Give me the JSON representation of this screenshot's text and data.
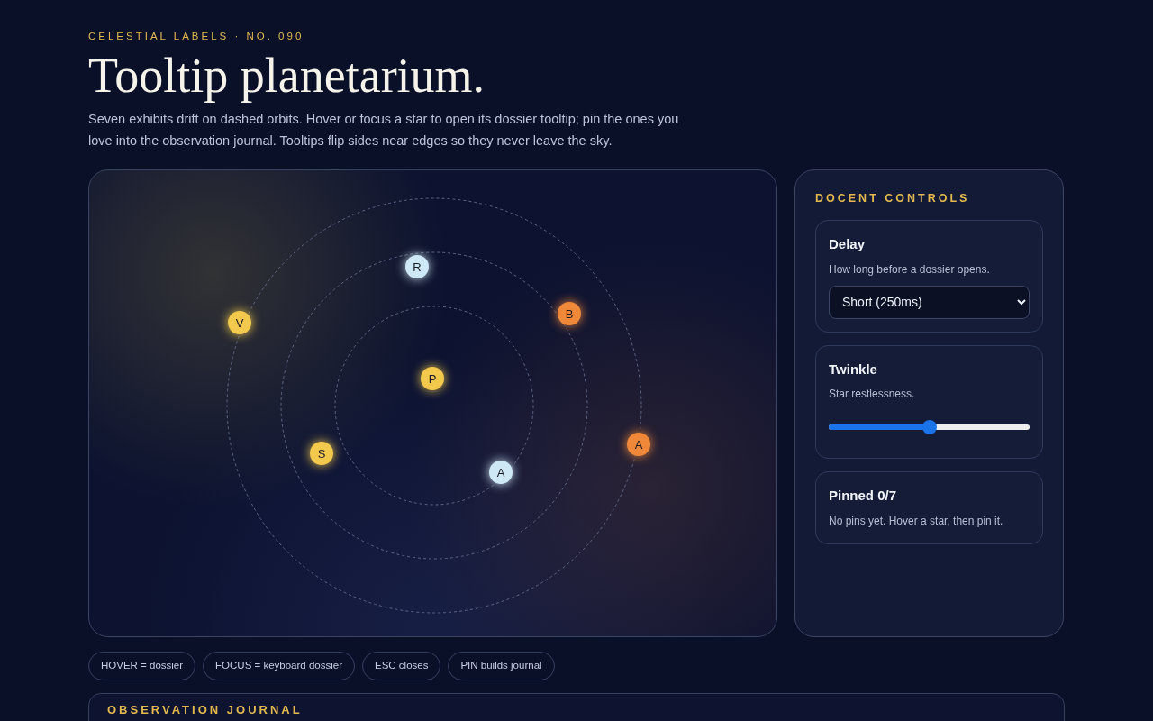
{
  "eyebrow": "CELESTIAL LABELS · NO. 090",
  "title": "Tooltip planetarium.",
  "intro": "Seven exhibits drift on dashed orbits. Hover or focus a star to open its dossier tooltip; pin the ones you love into the observation journal. Tooltips flip sides near edges so they never leave the sky.",
  "stars": [
    {
      "label": "R",
      "color": "#cfe8f5"
    },
    {
      "label": "B",
      "color": "#f0883a"
    },
    {
      "label": "V",
      "color": "#f2c94c"
    },
    {
      "label": "P",
      "color": "#f2c94c"
    },
    {
      "label": "S",
      "color": "#f2c94c"
    },
    {
      "label": "A",
      "color": "#cfe8f5"
    },
    {
      "label": "A",
      "color": "#f0883a"
    }
  ],
  "controls": {
    "title": "DOCENT CONTROLS",
    "cards": [
      {
        "kind": "select",
        "title": "Delay",
        "hint": "How long before a dossier opens.",
        "value": "Short (250ms)"
      },
      {
        "kind": "slider",
        "title": "Twinkle",
        "hint": "Star restlessness.",
        "level": 0.5
      },
      {
        "kind": "text",
        "title": "Pinned 0/7",
        "hint": "No pins yet. Hover a star, then pin it."
      }
    ]
  },
  "chips": [
    "HOVER = dossier",
    "FOCUS = keyboard dossier",
    "ESC closes",
    "PIN builds journal"
  ],
  "journal": {
    "title": "OBSERVATION JOURNAL"
  }
}
